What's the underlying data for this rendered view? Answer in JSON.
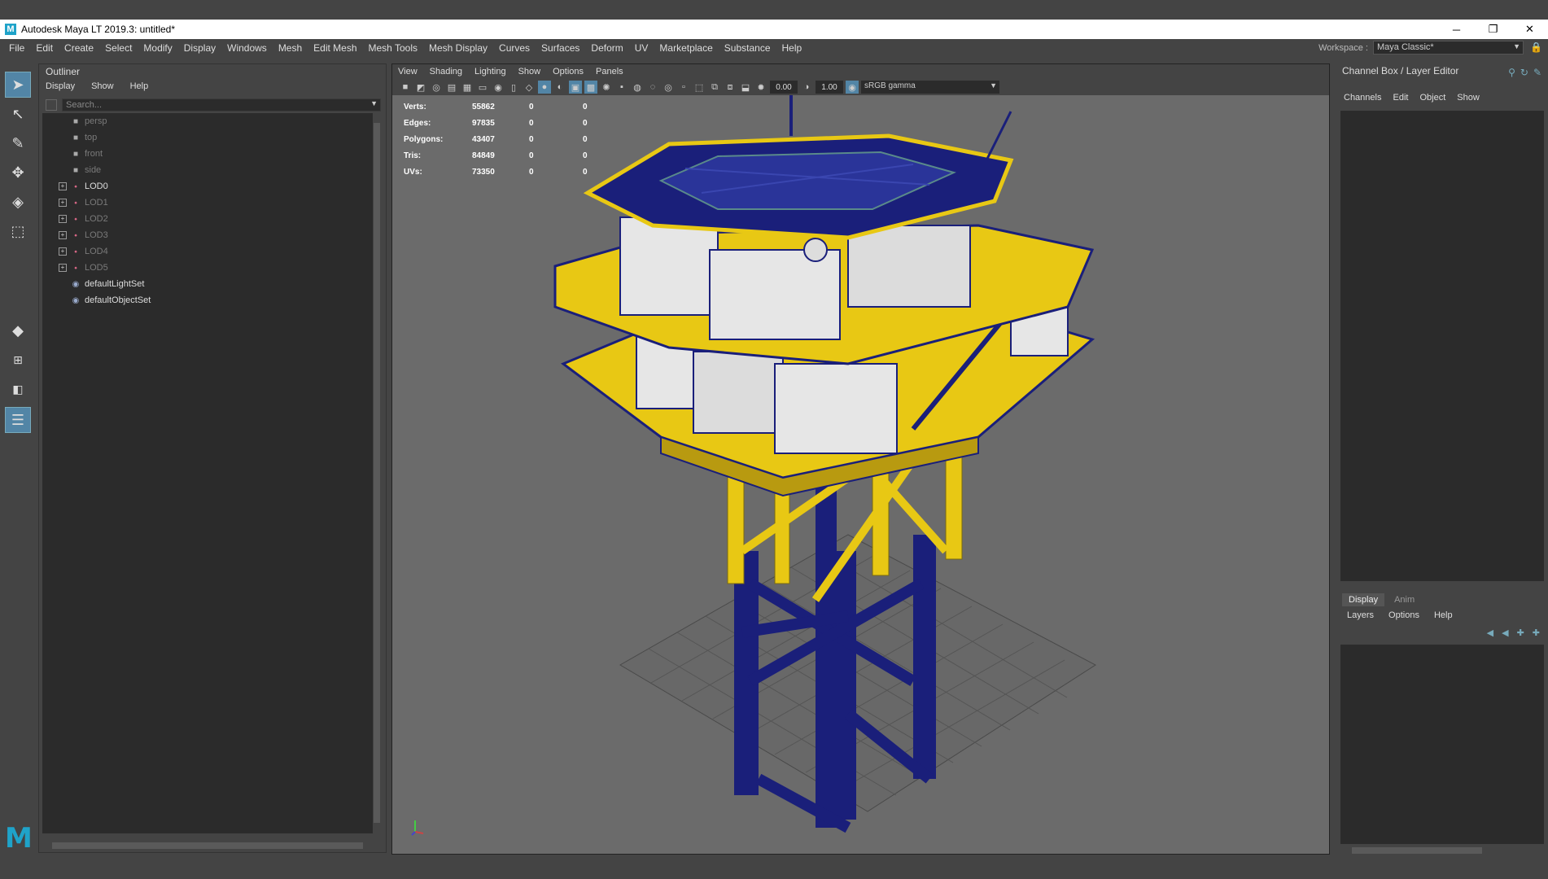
{
  "window": {
    "title": "Autodesk Maya LT 2019.3: untitled*",
    "logo_letter": "M",
    "minimize": "─",
    "maximize": "❐",
    "close": "✕"
  },
  "menubar": {
    "items": [
      "File",
      "Edit",
      "Create",
      "Select",
      "Modify",
      "Display",
      "Windows",
      "Mesh",
      "Edit Mesh",
      "Mesh Tools",
      "Mesh Display",
      "Curves",
      "Surfaces",
      "Deform",
      "UV",
      "Marketplace",
      "Substance",
      "Help"
    ],
    "workspace_label": "Workspace :",
    "workspace_value": "Maya Classic*"
  },
  "outliner": {
    "title": "Outliner",
    "menu": [
      "Display",
      "Show",
      "Help"
    ],
    "search_placeholder": "Search...",
    "items": [
      {
        "label": "persp",
        "type": "camera",
        "dim": true,
        "expandable": false
      },
      {
        "label": "top",
        "type": "camera",
        "dim": true,
        "expandable": false
      },
      {
        "label": "front",
        "type": "camera",
        "dim": true,
        "expandable": false
      },
      {
        "label": "side",
        "type": "camera",
        "dim": true,
        "expandable": false
      },
      {
        "label": "LOD0",
        "type": "group",
        "dim": false,
        "expandable": true
      },
      {
        "label": "LOD1",
        "type": "group",
        "dim": true,
        "expandable": true
      },
      {
        "label": "LOD2",
        "type": "group",
        "dim": true,
        "expandable": true
      },
      {
        "label": "LOD3",
        "type": "group",
        "dim": true,
        "expandable": true
      },
      {
        "label": "LOD4",
        "type": "group",
        "dim": true,
        "expandable": true
      },
      {
        "label": "LOD5",
        "type": "group",
        "dim": true,
        "expandable": true
      },
      {
        "label": "defaultLightSet",
        "type": "set",
        "dim": false,
        "expandable": false
      },
      {
        "label": "defaultObjectSet",
        "type": "set",
        "dim": false,
        "expandable": false
      }
    ]
  },
  "viewport": {
    "menu": [
      "View",
      "Shading",
      "Lighting",
      "Show",
      "Options",
      "Panels"
    ],
    "exposure": "0.00",
    "gamma_value": "1.00",
    "color_space": "sRGB gamma",
    "hud": [
      {
        "key": "Verts:",
        "value": "55862",
        "sel": "0",
        "comp": "0"
      },
      {
        "key": "Edges:",
        "value": "97835",
        "sel": "0",
        "comp": "0"
      },
      {
        "key": "Polygons:",
        "value": "43407",
        "sel": "0",
        "comp": "0"
      },
      {
        "key": "Tris:",
        "value": "84849",
        "sel": "0",
        "comp": "0"
      },
      {
        "key": "UVs:",
        "value": "73350",
        "sel": "0",
        "comp": "0"
      }
    ]
  },
  "channelbox": {
    "title": "Channel Box / Layer Editor",
    "menu": [
      "Channels",
      "Edit",
      "Object",
      "Show"
    ]
  },
  "layereditor": {
    "tabs": [
      "Display",
      "Anim"
    ],
    "menu": [
      "Layers",
      "Options",
      "Help"
    ]
  },
  "colors": {
    "accent": "#5285a6",
    "wire_blue": "#1a1f7a",
    "structure_yellow": "#e8c814",
    "container_white": "#e6e6e6"
  }
}
